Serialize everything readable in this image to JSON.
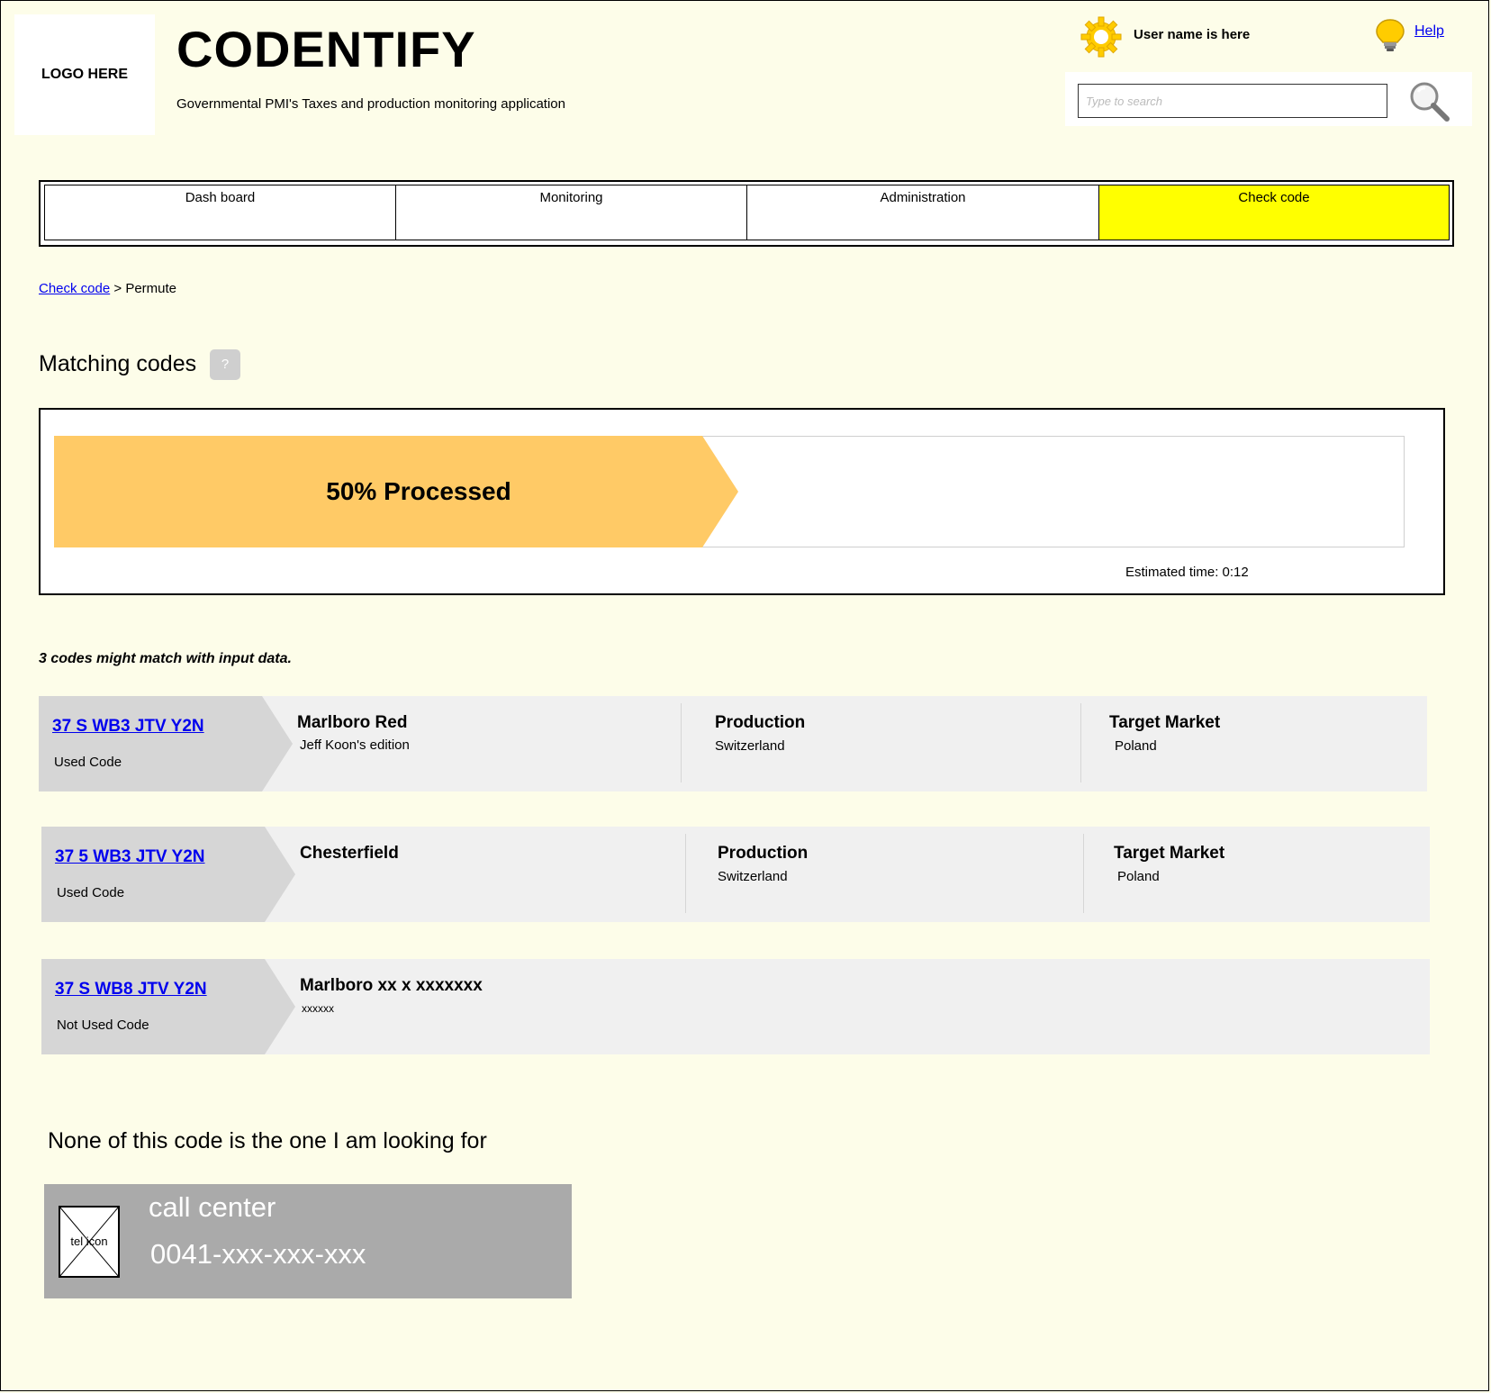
{
  "header": {
    "logo_text": "LOGO HERE",
    "app_title": "CODENTIFY",
    "app_subtitle": "Governmental PMI's Taxes and production monitoring application",
    "user_name": "User name is here",
    "help_label": "Help",
    "search_placeholder": "Type to search",
    "icons": {
      "user": "gear-icon",
      "help": "lightbulb-icon",
      "search": "magnifier-icon"
    },
    "colors": {
      "gear": "#ffcc00",
      "bulb": "#ffcc00"
    }
  },
  "nav": {
    "tabs": [
      {
        "label": "Dash board",
        "active": false
      },
      {
        "label": "Monitoring",
        "active": false
      },
      {
        "label": "Administration",
        "active": false
      },
      {
        "label": "Check code",
        "active": true
      }
    ],
    "active_color": "#ffff00"
  },
  "breadcrumb": {
    "link": "Check code",
    "separator": " > ",
    "current": "Permute"
  },
  "section": {
    "title": "Matching codes",
    "help_badge": "?"
  },
  "progress": {
    "label": "50% Processed",
    "percent": 50,
    "estimated_time": "Estimated time: 0:12",
    "color": "#ffca66"
  },
  "match_summary": "3 codes might match with input data.",
  "results": [
    {
      "code": "37 S WB3 JTV Y2N",
      "status": "Used Code",
      "product": "Marlboro Red",
      "product_sub": "Jeff Koon's edition",
      "production_title": "Production",
      "production_value": "Switzerland",
      "market_title": "Target Market",
      "market_value": "Poland"
    },
    {
      "code": "37 5 WB3 JTV Y2N",
      "status": "Used Code",
      "product": "Chesterfield",
      "product_sub": "",
      "production_title": "Production",
      "production_value": "Switzerland",
      "market_title": "Target Market",
      "market_value": "Poland"
    },
    {
      "code": "37 S WB8 JTV Y2N",
      "status": "Not Used Code",
      "product": "Marlboro xx x xxxxxxx",
      "product_sub": "xxxxxx"
    }
  ],
  "fallback": {
    "text": "None of this code is the one I am looking for",
    "call_title": "call center",
    "call_phone": "0041-xxx-xxx-xxx",
    "tel_icon_label": "tel icon"
  }
}
